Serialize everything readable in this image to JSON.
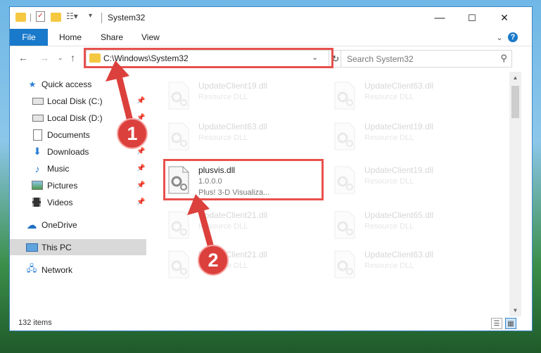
{
  "window": {
    "title": "System32",
    "controls": {
      "minimize": "—",
      "maximize": "☐",
      "close": "✕"
    }
  },
  "ribbon": {
    "tabs": [
      "File",
      "Home",
      "Share",
      "View"
    ],
    "expand_icon": "⌄",
    "help_icon": "?"
  },
  "address": {
    "path": "C:\\Windows\\System32",
    "dropdown_icon": "⌄",
    "refresh_icon": "↻"
  },
  "search": {
    "placeholder": "Search System32",
    "icon": "search-icon"
  },
  "sidebar": {
    "items": [
      {
        "label": "Quick access",
        "icon": "star-icon",
        "pinned": false
      },
      {
        "label": "Local Disk (C:)",
        "icon": "drive-icon",
        "pinned": true
      },
      {
        "label": "Local Disk (D:)",
        "icon": "drive-icon",
        "pinned": true
      },
      {
        "label": "Documents",
        "icon": "documents-icon",
        "pinned": true
      },
      {
        "label": "Downloads",
        "icon": "download-icon",
        "pinned": true
      },
      {
        "label": "Music",
        "icon": "music-icon",
        "pinned": true
      },
      {
        "label": "Pictures",
        "icon": "pictures-icon",
        "pinned": true
      },
      {
        "label": "Videos",
        "icon": "videos-icon",
        "pinned": true
      },
      {
        "label": "OneDrive",
        "icon": "cloud-icon",
        "pinned": false
      },
      {
        "label": "This PC",
        "icon": "computer-icon",
        "pinned": false,
        "selected": true
      },
      {
        "label": "Network",
        "icon": "network-icon",
        "pinned": false
      }
    ]
  },
  "files": {
    "left_column": [
      {
        "name": "UpdateClient19.dll",
        "line2": "Resource DLL"
      },
      {
        "name": "UpdateClient63.dll",
        "line2": "Resource DLL"
      },
      {
        "name": "plusvis.dll",
        "line2": "1.0.0.0",
        "line3": "Plus! 3-D Visualiza...",
        "highlighted": true
      },
      {
        "name": "UpdateClient21.dll",
        "line2": "Resource DLL"
      },
      {
        "name": "UpdateClient21.dll",
        "line2": "Resource DLL"
      }
    ],
    "right_column": [
      {
        "name": "UpdateClient63.dll",
        "line2": "Resource DLL"
      },
      {
        "name": "UpdateClient19.dll",
        "line2": "Resource DLL"
      },
      {
        "name": "UpdateClient19.dll",
        "line2": "Resource DLL"
      },
      {
        "name": "UpdateClient65.dll",
        "line2": "Resource DLL"
      },
      {
        "name": "UpdateClient63.dll",
        "line2": "Resource DLL"
      }
    ]
  },
  "status": {
    "item_count": "132 items"
  },
  "annotations": {
    "step1": "1",
    "step2": "2",
    "accent_color": "#e8514e"
  }
}
